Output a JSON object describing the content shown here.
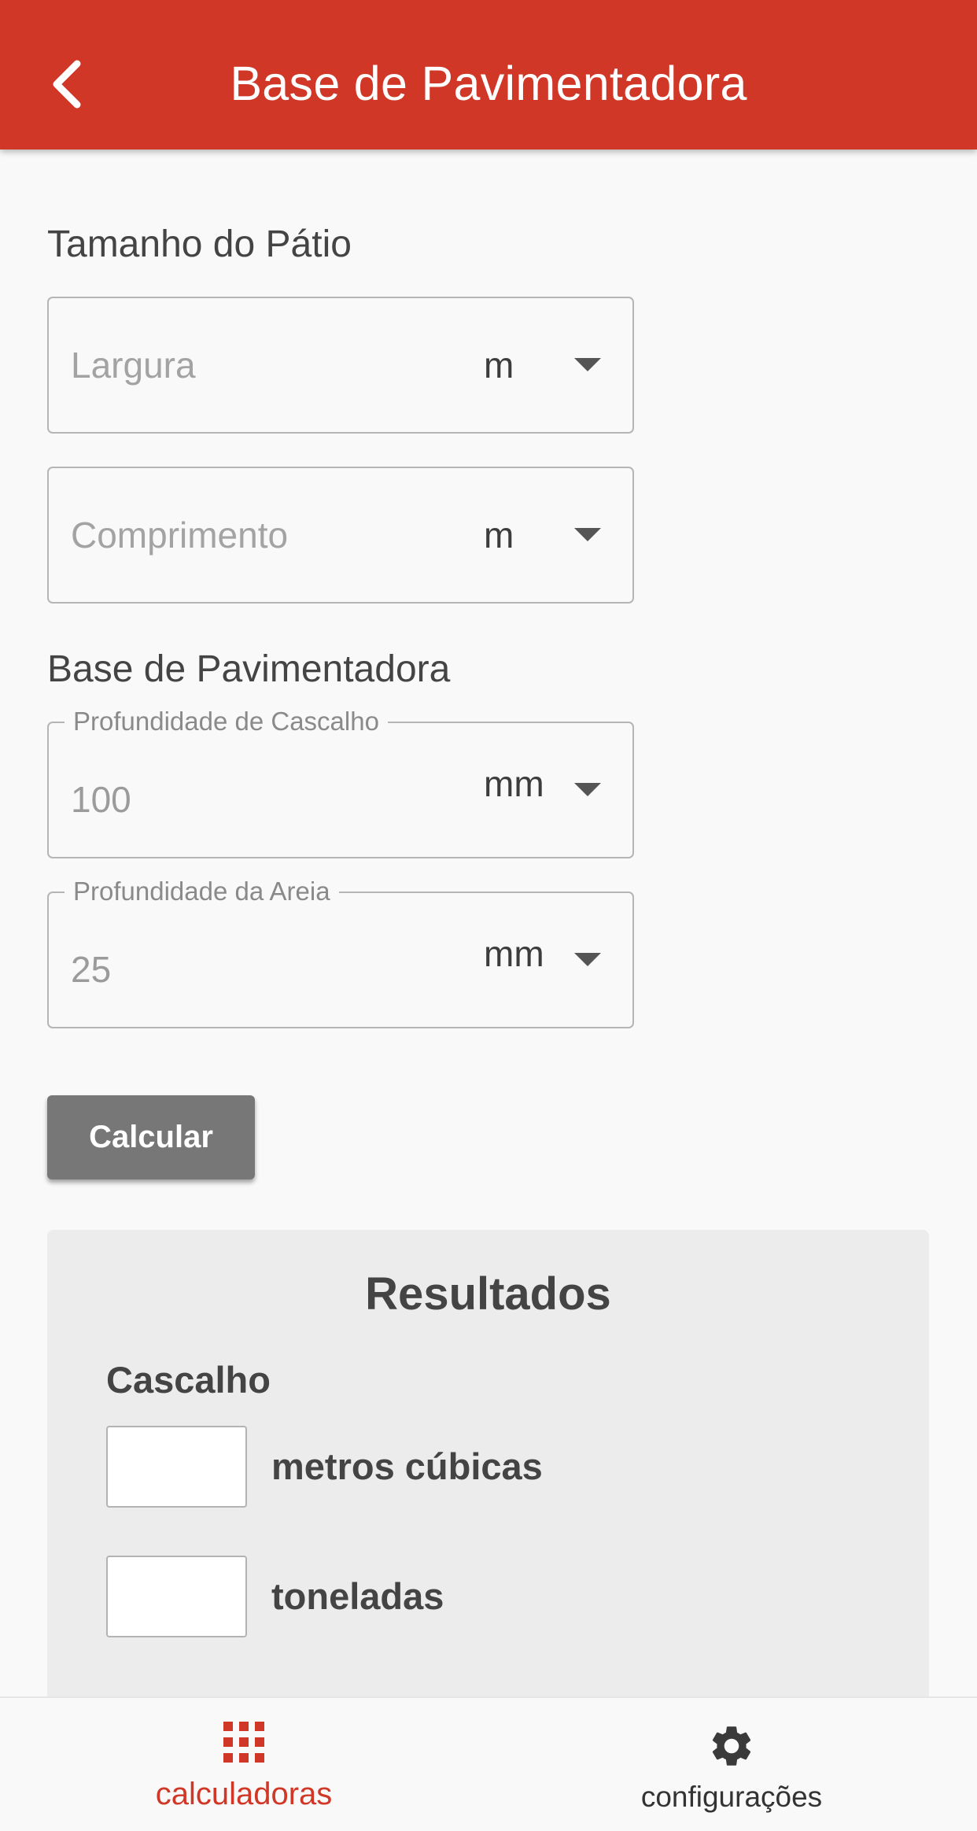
{
  "appbar": {
    "title": "Base de Pavimentadora",
    "color": "#d13727"
  },
  "patio": {
    "heading": "Tamanho do Pátio",
    "width": {
      "placeholder": "Largura",
      "unit": "m"
    },
    "length": {
      "placeholder": "Comprimento",
      "unit": "m"
    }
  },
  "base": {
    "heading": "Base de Pavimentadora",
    "gravel": {
      "label": "Profundidade de Cascalho",
      "value": "100",
      "unit": "mm"
    },
    "sand": {
      "label": "Profundidade da Areia",
      "value": "25",
      "unit": "mm"
    }
  },
  "calculate_label": "Calcular",
  "results": {
    "title": "Resultados",
    "gravel_heading": "Cascalho",
    "cubic_meters_label": "metros cúbicas",
    "tons_label": "toneladas",
    "cubic_meters_value": "",
    "tons_value": ""
  },
  "bottom_nav": {
    "calculators_label": "calculadoras",
    "settings_label": "configurações",
    "calculators_icon": "grid-icon",
    "settings_icon": "gear-icon",
    "active_color": "#d13727"
  }
}
